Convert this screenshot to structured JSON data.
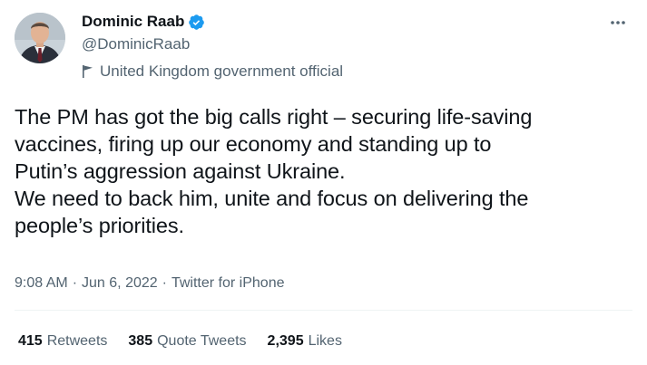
{
  "author": {
    "display_name": "Dominic Raab",
    "handle": "@DominicRaab",
    "verified": true,
    "affiliation": "United Kingdom government official"
  },
  "icons": {
    "verified": "verified-badge-icon",
    "affiliation": "flag-icon",
    "more": "more-dots-icon"
  },
  "tweet": {
    "text": "The PM has got the big calls right – securing life-saving\nvaccines, firing up our economy and standing up to\nPutin’s aggression against Ukraine.\nWe need to back him, unite and focus on delivering the\npeople’s priorities."
  },
  "meta": {
    "time": "9:08 AM",
    "separator": "·",
    "date": "Jun 6, 2022",
    "source": "Twitter for iPhone"
  },
  "stats": {
    "retweets_count": "415",
    "retweets_label": "Retweets",
    "quotes_count": "385",
    "quotes_label": "Quote Tweets",
    "likes_count": "2,395",
    "likes_label": "Likes"
  },
  "colors": {
    "verified": "#1d9bf0",
    "secondary_text": "#536471",
    "primary_text": "#0f1419"
  }
}
